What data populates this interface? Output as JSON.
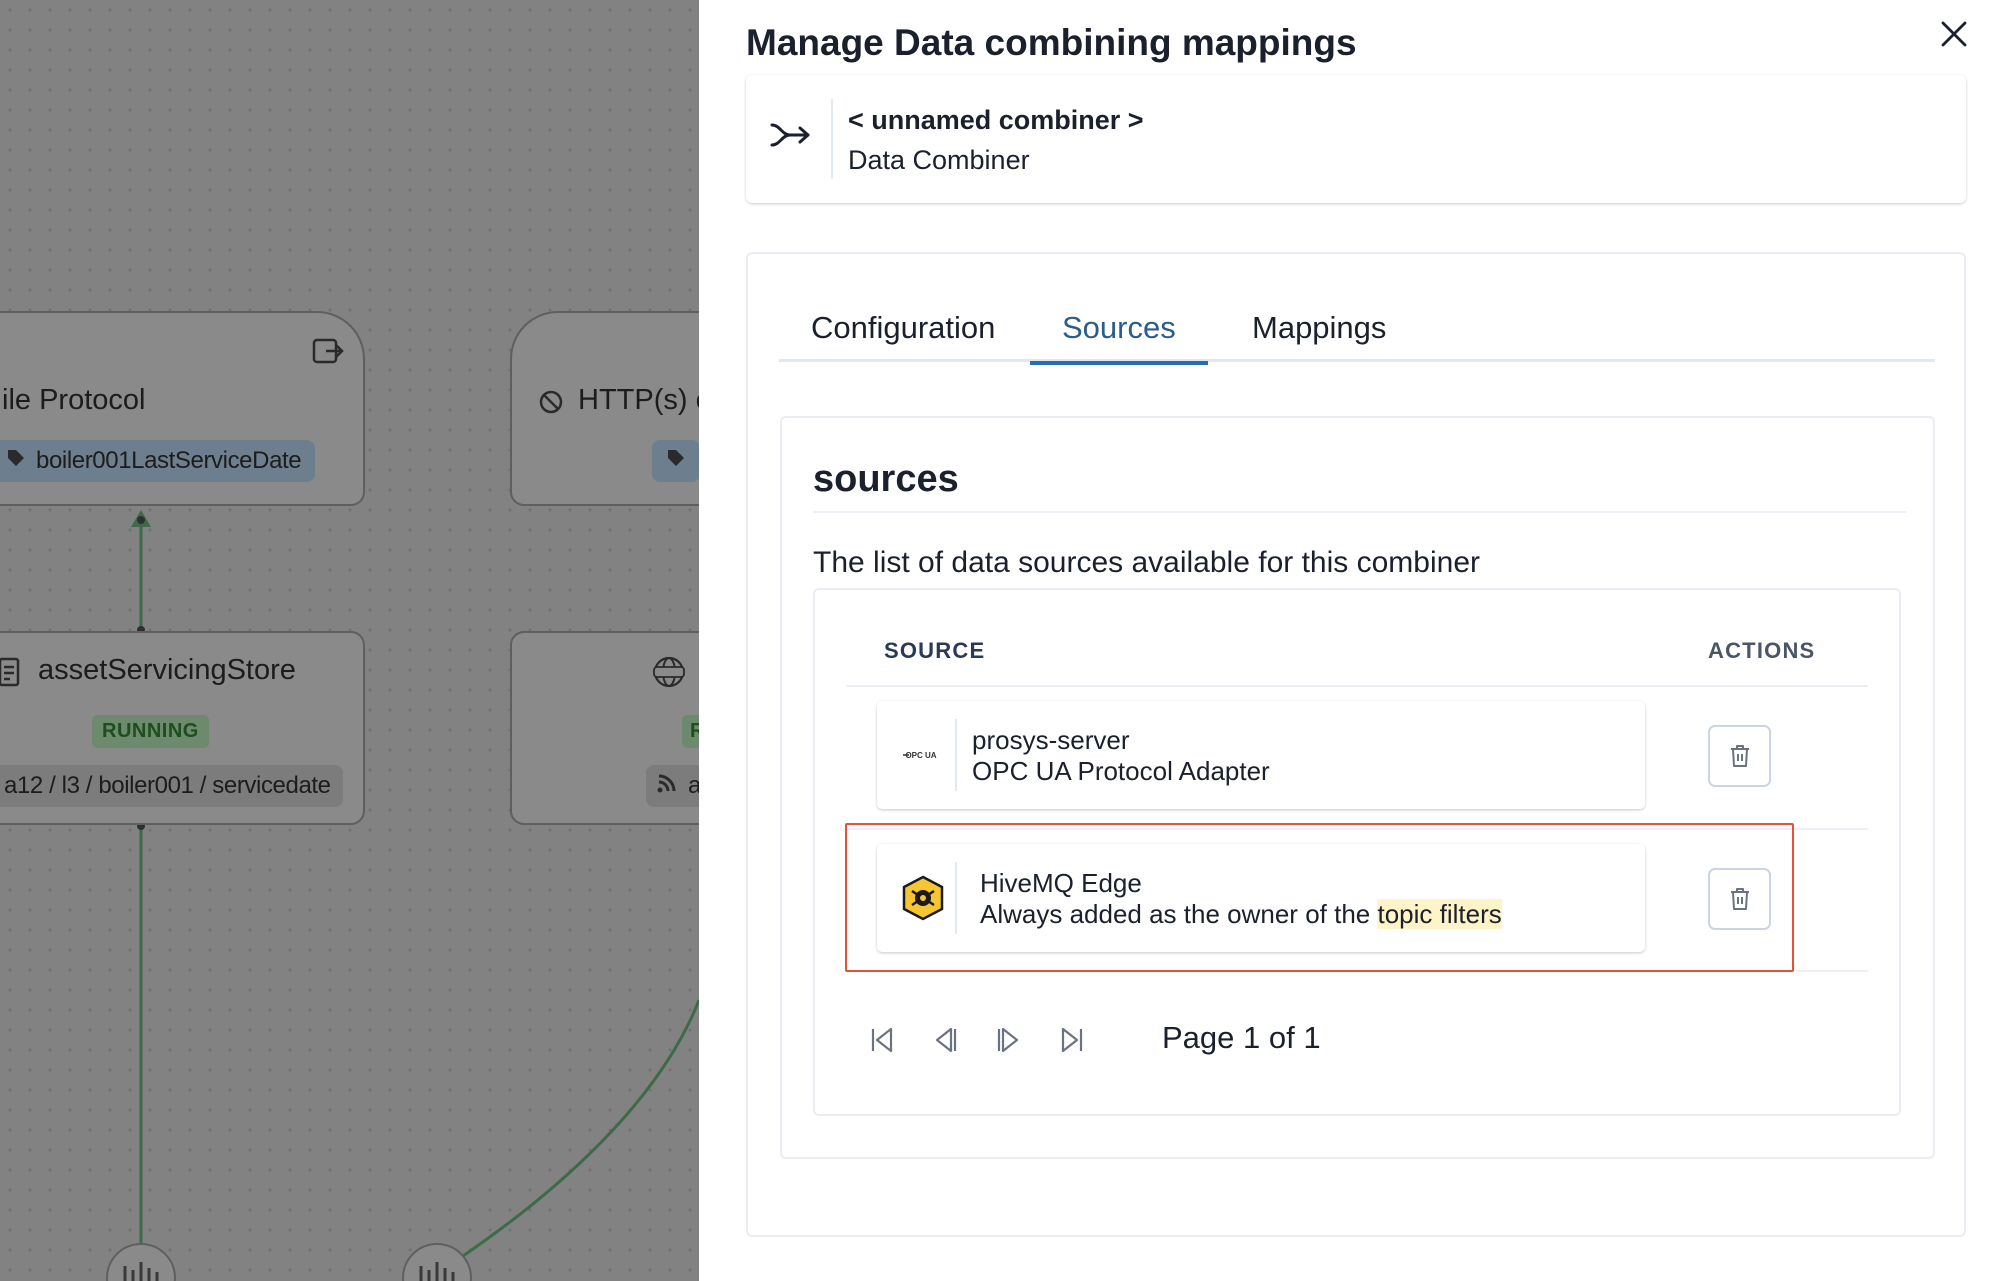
{
  "canvas": {
    "node1": {
      "title": "ile Protocol",
      "tag": "boiler001LastServiceDate"
    },
    "node2": {
      "title": "HTTP(s) c"
    },
    "node3": {
      "title": "assetServicingStore",
      "status": "RUNNING",
      "topic": "a12 / l3 / boiler001 / servicedate"
    },
    "node4": {
      "status": "R",
      "topic": "a"
    }
  },
  "drawer": {
    "title": "Manage Data combining mappings",
    "close_icon": "close-icon",
    "combiner": {
      "icon": "combine-arrow-icon",
      "name": "< unnamed combiner >",
      "type": "Data Combiner"
    },
    "tabs": [
      {
        "label": "Configuration",
        "active": false
      },
      {
        "label": "Sources",
        "active": true
      },
      {
        "label": "Mappings",
        "active": false
      }
    ],
    "sources": {
      "heading": "sources",
      "description": "The list of data sources available for this combiner",
      "columns": {
        "source": "SOURCE",
        "actions": "ACTIONS"
      },
      "rows": [
        {
          "logo": "opc-ua-logo",
          "logo_text": "OPC UA",
          "name": "prosys-server",
          "description": "OPC UA Protocol Adapter"
        },
        {
          "logo": "hivemq-bee-logo",
          "name": "HiveMQ Edge",
          "description_prefix": "Always added as the owner of the ",
          "description_highlight": "topic filters"
        }
      ],
      "pagination": {
        "first_icon": "first-page-icon",
        "prev_icon": "previous-page-icon",
        "next_icon": "next-page-icon",
        "last_icon": "last-page-icon",
        "label": "Page 1 of 1"
      }
    }
  },
  "colors": {
    "accent": "#2b6cb0",
    "highlight_box": "#e2533a",
    "highlight_text_bg": "#fef4c8",
    "canvas_overlay": "#828282",
    "edge_green": "#3d6b47"
  }
}
